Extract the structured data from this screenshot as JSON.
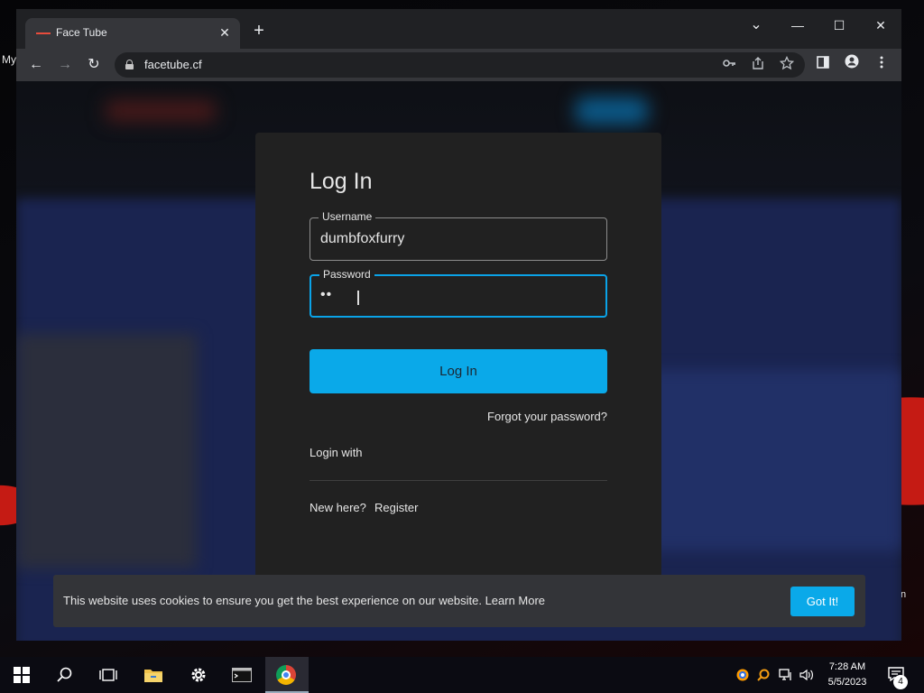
{
  "desktop": {
    "left_label": "My",
    "right_label": "n"
  },
  "browser": {
    "tab": {
      "title": "Face Tube",
      "close": "✕",
      "favicon": "facetube-favicon-icon"
    },
    "new_tab": "+",
    "window_controls": {
      "tab_search": "⌄",
      "minimize": "—",
      "maximize": "☐",
      "close": "✕"
    },
    "nav": {
      "back": "←",
      "forward": "→",
      "reload": "↻"
    },
    "omnibox": {
      "url": "facetube.cf"
    },
    "toolbar_icons": [
      "key-icon",
      "share-icon",
      "star-icon",
      "side-panel-icon",
      "profile-icon",
      "menu-icon"
    ]
  },
  "login": {
    "title": "Log In",
    "username": {
      "label": "Username",
      "value": "dumbfoxfurry"
    },
    "password": {
      "label": "Password",
      "value": "••"
    },
    "submit": "Log In",
    "forgot": "Forgot your password?",
    "login_with": "Login with",
    "new_here": "New here?",
    "register": "Register"
  },
  "cookie": {
    "text": "This website uses cookies to ensure you get the best experience on our website.",
    "learn_more": "Learn More",
    "button": "Got It!"
  },
  "taskbar": {
    "time": "7:28 AM",
    "date": "5/5/2023",
    "notifications": "4"
  },
  "colors": {
    "accent": "#0aa9e9",
    "modal_bg": "#212121",
    "browser_bg": "#202124",
    "toolbar_bg": "#35363a"
  }
}
